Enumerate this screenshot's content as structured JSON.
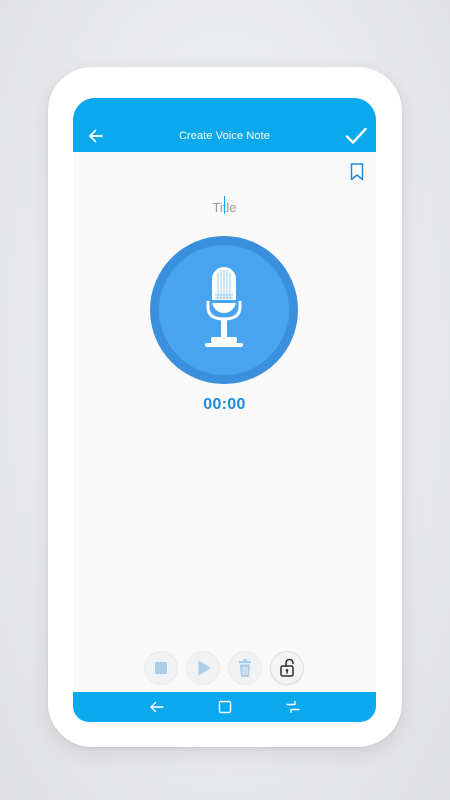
{
  "app_bar": {
    "title": "Create Voice Note"
  },
  "icons": {
    "back": "arrow-left-icon",
    "save": "checkmark-icon",
    "bookmark": "bookmark-icon",
    "mic": "microphone-icon",
    "stop": "stop-icon",
    "play": "play-icon",
    "delete": "trash-icon",
    "lock": "unlocked-padlock-icon"
  },
  "title_field": {
    "placeholder": "Title",
    "value": ""
  },
  "recorder": {
    "timer": "00:00"
  },
  "colors": {
    "accent": "#0aa8ec",
    "record_outer": "#3a90dd",
    "record_inner": "#48a4ef",
    "timer": "#1b8bdc",
    "control_icon": "#aacde9"
  }
}
